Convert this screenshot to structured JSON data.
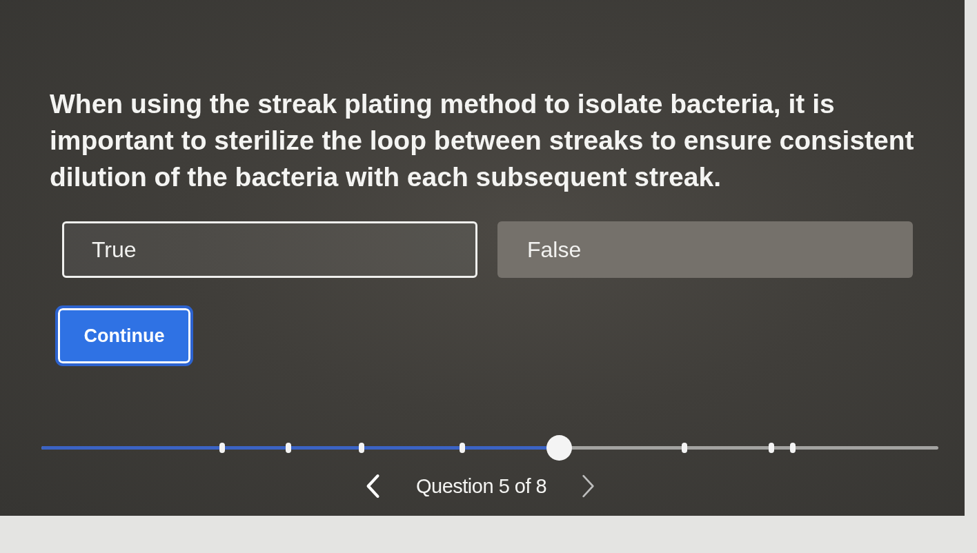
{
  "question": {
    "text": "When using the streak plating method to isolate bacteria, it is important to sterilize the loop between streaks to ensure consistent dilution of the bacteria with each subsequent streak."
  },
  "options": [
    {
      "label": "True",
      "selected": true
    },
    {
      "label": "False",
      "selected": false
    }
  ],
  "continue_button": {
    "label": "Continue"
  },
  "progress": {
    "level": 0.58,
    "markers": [
      {
        "selected": false
      },
      {
        "selected": false
      },
      {
        "selected": false
      },
      {
        "selected": false
      },
      {
        "selected": true
      },
      {
        "selected": false
      },
      {
        "selected": false
      },
      {
        "selected": false
      }
    ]
  },
  "navigation": {
    "previous": {
      "disabled": false
    },
    "label": "Question 5 of 8",
    "next": {
      "disabled": true
    }
  }
}
